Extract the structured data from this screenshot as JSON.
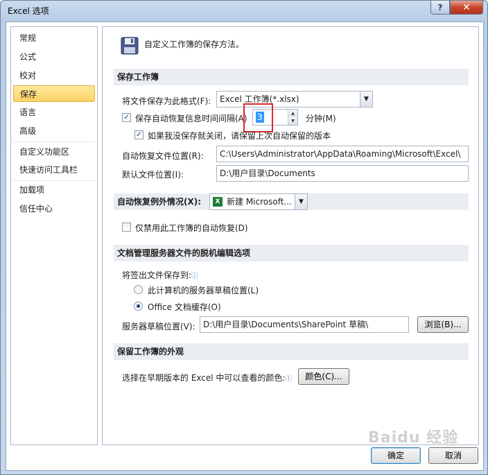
{
  "window": {
    "title": "Excel 选项",
    "help_label": "?",
    "close_label": "✕"
  },
  "nav": {
    "items": [
      {
        "label": "常规"
      },
      {
        "label": "公式"
      },
      {
        "label": "校对"
      },
      {
        "label": "保存"
      },
      {
        "label": "语言"
      },
      {
        "label": "高级"
      },
      {
        "label": "自定义功能区"
      },
      {
        "label": "快速访问工具栏"
      },
      {
        "label": "加载项"
      },
      {
        "label": "信任中心"
      }
    ],
    "selected": "保存"
  },
  "content": {
    "header": "自定义工作簿的保存方法。",
    "sections": {
      "save_workbooks": "保存工作簿",
      "autorecover_exceptions": "自动恢复例外情况(X):",
      "offline_editing": "文档管理服务器文件的脱机编辑选项",
      "preserve_visual": "保留工作簿的外观"
    },
    "save_format": {
      "label": "将文件保存为此格式(F):",
      "value": "Excel 工作簿(*.xlsx)"
    },
    "autorecover": {
      "checkbox_label": "保存自动恢复信息时间间隔(A)",
      "checked": true,
      "minutes_value": "3",
      "minutes_unit": "分钟(M)"
    },
    "keep_last": {
      "label": "如果我没保存就关闭，请保留上次自动保留的版本",
      "checked": true
    },
    "autorecover_location": {
      "label": "自动恢复文件位置(R):",
      "value": "C:\\Users\\Administrator\\AppData\\Roaming\\Microsoft\\Excel\\"
    },
    "default_location": {
      "label": "默认文件位置(I):",
      "value": "D:\\用户目录\\Documents"
    },
    "exceptions_combo": {
      "value": "新建 Microsoft..."
    },
    "disable_autorecover": {
      "label": "仅禁用此工作簿的自动恢复(D)",
      "checked": false
    },
    "checkout": {
      "label": "将签出文件保存到:",
      "option_server": "此计算机的服务器草稿位置(L)",
      "option_cache": "Office 文档缓存(O)",
      "selected": "Office 文档缓存(O)"
    },
    "server_drafts": {
      "label": "服务器草稿位置(V):",
      "value": "D:\\用户目录\\Documents\\SharePoint 草稿\\",
      "browse_label": "浏览(B)..."
    },
    "colors": {
      "label": "选择在早期版本的 Excel 中可以查看的颜色:",
      "button_label": "颜色(C)..."
    }
  },
  "footer": {
    "ok_label": "确定",
    "cancel_label": "取消"
  },
  "watermark": "Baidu 经验",
  "colors": {
    "selected_nav": "#fbd365",
    "highlight_box": "#e0282d",
    "selection_blue": "#3399ff"
  }
}
